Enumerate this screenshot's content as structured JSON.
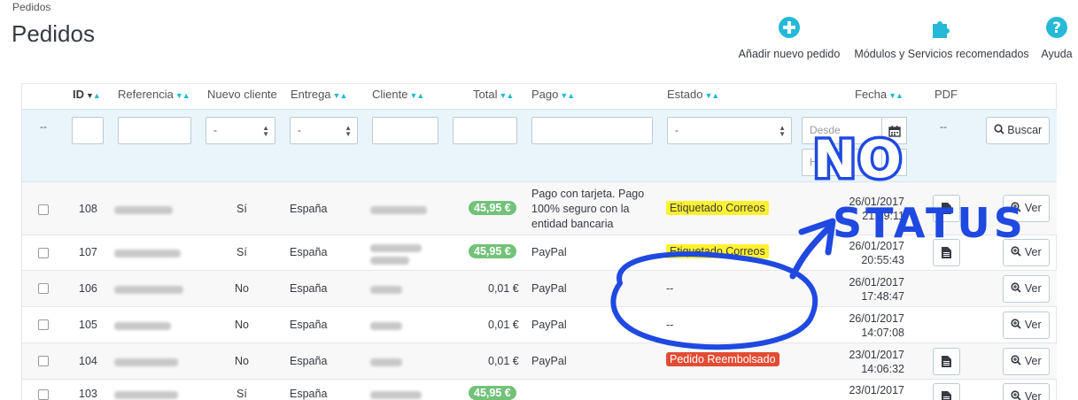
{
  "header": {
    "breadcrumb": "Pedidos",
    "title": "Pedidos",
    "toolbar": [
      {
        "label": "Añadir nuevo pedido",
        "icon": "plus-circle-icon"
      },
      {
        "label": "Módulos y Servicios recomendados",
        "icon": "puzzle-icon"
      },
      {
        "label": "Ayuda",
        "icon": "help-icon"
      }
    ]
  },
  "columns": {
    "id": "ID",
    "reference": "Referencia",
    "new_customer": "Nuevo cliente",
    "delivery": "Entrega",
    "customer": "Cliente",
    "total": "Total",
    "payment": "Pago",
    "status": "Estado",
    "date": "Fecha",
    "pdf": "PDF"
  },
  "filters": {
    "select_placeholder": "-",
    "from_placeholder": "Desde",
    "to_placeholder": "Hasta",
    "empty_mark": "--",
    "search_label": "Buscar"
  },
  "rows": [
    {
      "id": "108",
      "new": "Sí",
      "country": "España",
      "total": "45,95 €",
      "payment": "Pago con tarjeta. Pago 100% seguro con la entidad bancaria",
      "status": "Etiquetado Correos",
      "date": "26/01/2017",
      "time": "21:49:11"
    },
    {
      "id": "107",
      "new": "Sí",
      "country": "España",
      "total": "45,95 €",
      "payment": "PayPal",
      "status": "Etiquetado Correos",
      "date": "26/01/2017",
      "time": "20:55:43"
    },
    {
      "id": "106",
      "new": "No",
      "country": "España",
      "total": "0,01 €",
      "payment": "PayPal",
      "status": "--",
      "date": "26/01/2017",
      "time": "17:48:47"
    },
    {
      "id": "105",
      "new": "No",
      "country": "España",
      "total": "0,01 €",
      "payment": "PayPal",
      "status": "--",
      "date": "26/01/2017",
      "time": "14:07:08"
    },
    {
      "id": "104",
      "new": "No",
      "country": "España",
      "total": "0,01 €",
      "payment": "PayPal",
      "status": "Pedido Reembolsado",
      "date": "23/01/2017",
      "time": "14:06:32"
    },
    {
      "id": "103",
      "new": "Sí",
      "country": "España",
      "total": "45,95 €",
      "payment": "",
      "status": "",
      "date": "23/01/2017",
      "time": ""
    }
  ],
  "actions": {
    "view_label": "Ver"
  },
  "annotation": {
    "line1": "NO",
    "line2": "STATUS"
  },
  "colors": {
    "accent": "#25b9d7",
    "annotation": "#1f49e0",
    "yellow": "#fff130",
    "red": "#e24c34",
    "green": "#72c279"
  }
}
